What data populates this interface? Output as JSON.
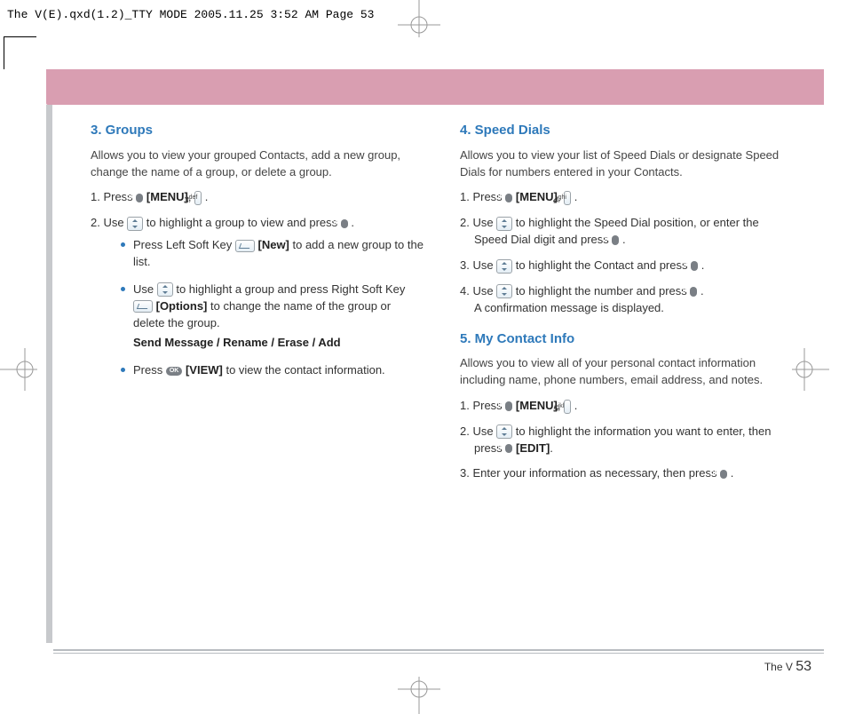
{
  "header_line": "The V(E).qxd(1.2)_TTY MODE  2005.11.25  3:52 AM  Page 53",
  "left": {
    "sec3": {
      "title": "3. Groups",
      "intro": "Allows you to view your grouped Contacts, add a new group, change the name of a group, or delete a group.",
      "s1a": "1.  Press ",
      "s1b": " [MENU]",
      "s1c": ", ",
      "key3": "3",
      "key3sup": "def",
      "s1d": " .",
      "s2a": "2.  Use  ",
      "s2b": "  to highlight a group to view and press  ",
      "s2c": " .",
      "b1a": "Press Left Soft Key ",
      "b1b": " [New]",
      "b1c": " to add a new group to the list.",
      "b2a": "Use  ",
      "b2b": " to highlight a group and press Right Soft Key ",
      "b2c": " [Options]",
      "b2d": " to change the name of the group or delete the group.",
      "b2opts": "Send Message / Rename / Erase / Add",
      "b3a": "Press  ",
      "b3b": " [VIEW]",
      "b3c": " to view the contact information."
    }
  },
  "right": {
    "sec4": {
      "title": "4. Speed Dials",
      "intro": "Allows you to view your list of Speed Dials or designate Speed Dials for numbers entered in your Contacts.",
      "s1a": "1.  Press ",
      "s1b": " [MENU]",
      "s1c": ", ",
      "key4": "4",
      "key4sup": "ghi",
      "s1d": " .",
      "s2a": "2.  Use  ",
      "s2b": "  to highlight the Speed Dial position, or enter the Speed Dial digit and press  ",
      "s2c": " .",
      "s3a": "3.  Use  ",
      "s3b": "  to highlight the Contact and press  ",
      "s3c": " .",
      "s4a": "4.  Use  ",
      "s4b": " to highlight the number and press  ",
      "s4c": " .",
      "s4d": "A confirmation message is displayed."
    },
    "sec5": {
      "title": "5. My Contact Info",
      "intro": "Allows you to view all of your personal contact information including name, phone numbers, email address, and notes.",
      "s1a": "1.  Press ",
      "s1b": " [MENU]",
      "s1c": ", ",
      "key5": "5",
      "key5sup": "jkl",
      "s1d": " .",
      "s2a": "2.  Use  ",
      "s2b": "  to highlight the information you want to enter, then press ",
      "s2c": " [EDIT]",
      "s2d": ".",
      "s3a": "3.  Enter your information as necessary, then press ",
      "s3b": " ."
    }
  },
  "footer": {
    "label": "The V",
    "page": "53"
  },
  "ok_label": "OK"
}
